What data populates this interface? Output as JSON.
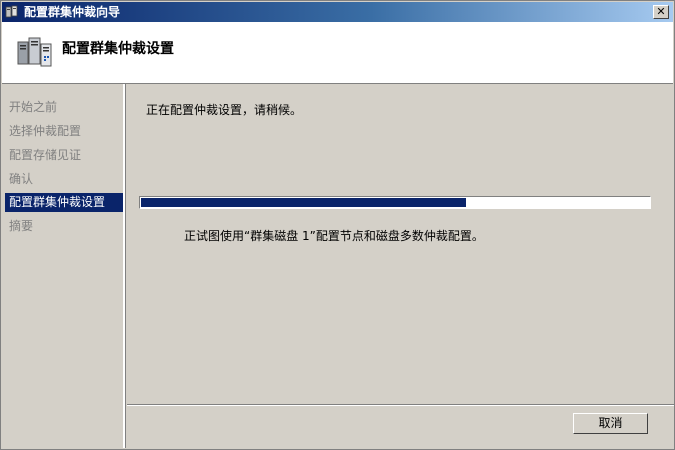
{
  "window": {
    "title": "配置群集仲裁向导",
    "close_label": "✕"
  },
  "header": {
    "title": "配置群集仲裁设置",
    "icon": "cluster-servers-icon"
  },
  "sidebar": {
    "items": [
      {
        "label": "开始之前",
        "active": false
      },
      {
        "label": "选择仲裁配置",
        "active": false
      },
      {
        "label": "配置存储见证",
        "active": false
      },
      {
        "label": "确认",
        "active": false
      },
      {
        "label": "配置群集仲裁设置",
        "active": true
      },
      {
        "label": "摘要",
        "active": false
      }
    ]
  },
  "main": {
    "status": "正在配置仲裁设置，请稍候。",
    "progress_fraction": 0.64,
    "detail": "正试图使用“群集磁盘 1”配置节点和磁盘多数仲裁配置。"
  },
  "footer": {
    "cancel_label": "取消"
  },
  "colors": {
    "titlebar_start": "#0a246a",
    "titlebar_end": "#a6caf0",
    "face": "#d4d0c8",
    "selection": "#0a246a",
    "progress": "#0a246a"
  }
}
